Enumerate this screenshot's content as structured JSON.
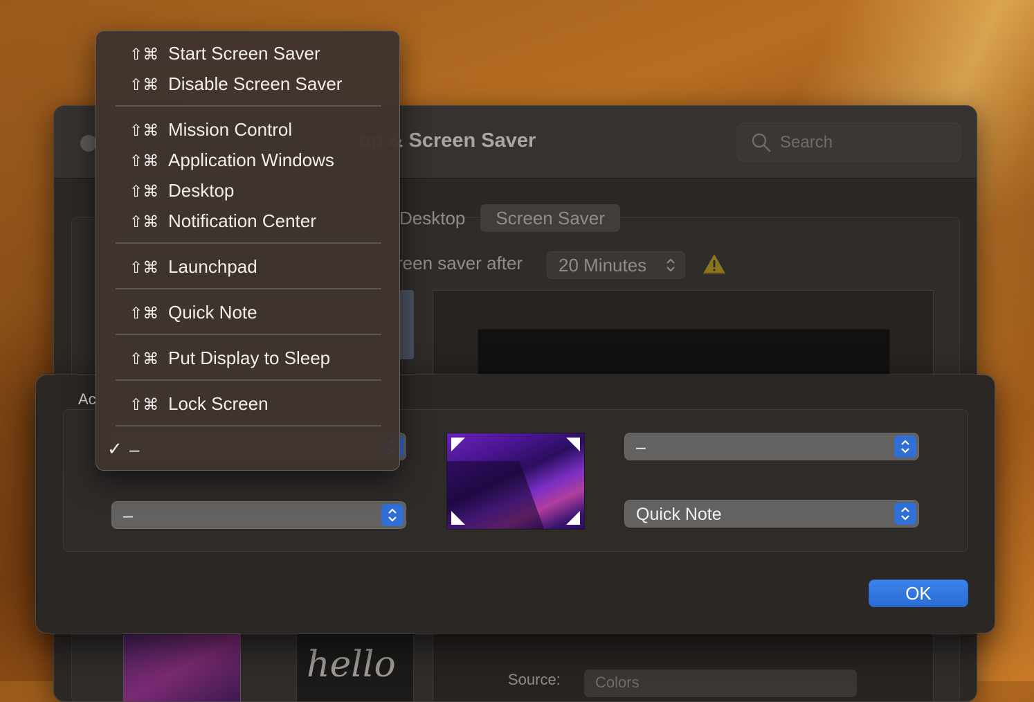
{
  "window": {
    "title": "op & Screen Saver",
    "search_placeholder": "Search",
    "tabs": [
      "Desktop",
      "Screen Saver"
    ],
    "start_after_label": "reen saver after",
    "start_after_value": "20 Minutes",
    "source_label": "Source:",
    "source_value": "Colors",
    "hello_text": "hello"
  },
  "sheet": {
    "label": "Ac",
    "top_left_value": "",
    "top_right_value": "–",
    "bottom_left_value": "–",
    "bottom_right_value": "Quick Note",
    "ok_label": "OK"
  },
  "menu": {
    "shortcut_glyph": "⇧⌘",
    "items": [
      "Start Screen Saver",
      "Disable Screen Saver",
      "Mission Control",
      "Application Windows",
      "Desktop",
      "Notification Center",
      "Launchpad",
      "Quick Note",
      "Put Display to Sleep",
      "Lock Screen"
    ],
    "selected_item": "–",
    "checkmark": "✓"
  },
  "colors": {
    "accent": "#2f6fd6",
    "warning": "#e2b324"
  }
}
